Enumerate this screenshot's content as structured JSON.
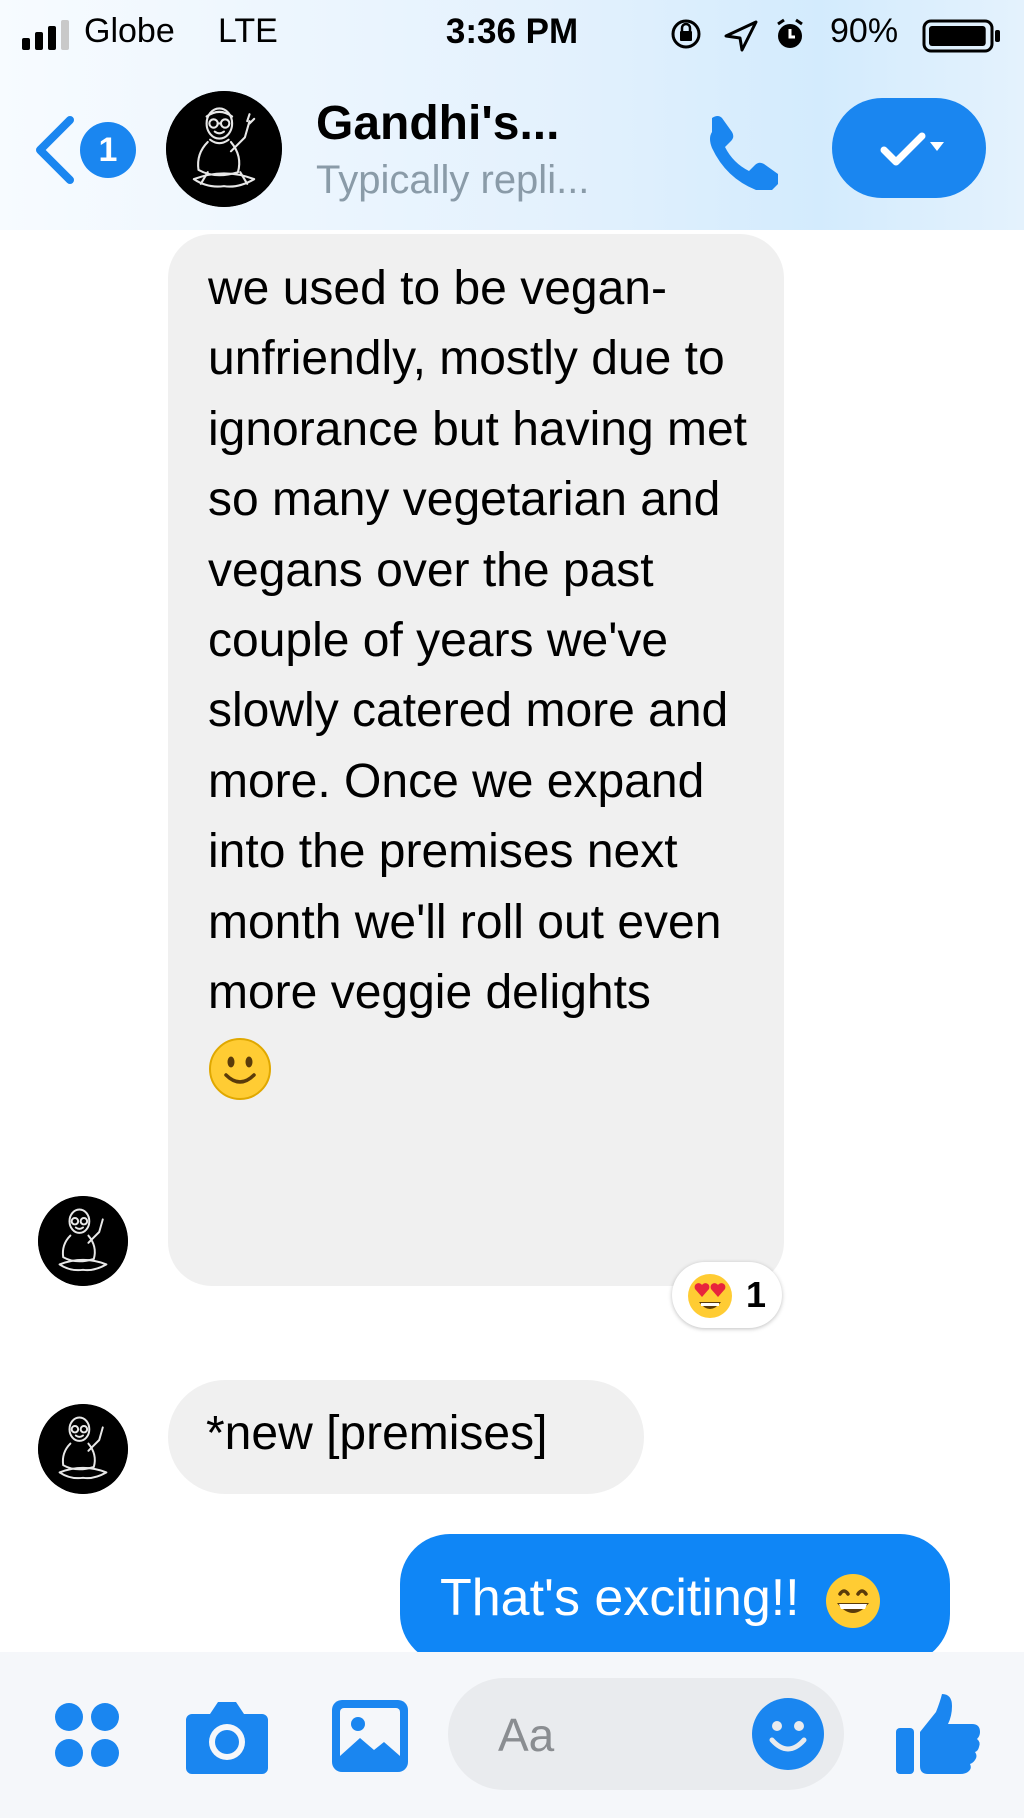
{
  "status_bar": {
    "carrier": "Globe",
    "network": "LTE",
    "time": "3:36 PM",
    "battery_percent": "90%",
    "signal_bars": 3,
    "battery_level": 0.9,
    "icons": [
      "signal-icon",
      "orientation-lock-icon",
      "location-icon",
      "alarm-icon",
      "battery-icon"
    ]
  },
  "header": {
    "back_badge_count": "1",
    "contact_name": "Gandhi's...",
    "subtitle": "Typically repli...",
    "icons": [
      "back-chevron-icon",
      "phone-icon",
      "checkmark-icon",
      "dropdown-caret-icon"
    ]
  },
  "messages": [
    {
      "sender": "contact",
      "text": "we used to be vegan-unfriendly, mostly due to ignorance but having met so many vegetarian and vegans over the past couple of years we've slowly catered more and more. Once we expand into the premises next month we'll roll out even more veggie delights",
      "trailing_emoji": "slightly-smiling-face-icon",
      "reaction": {
        "emoji": "heart-eyes-icon",
        "count": "1"
      }
    },
    {
      "sender": "contact",
      "text": "*new [premises]"
    },
    {
      "sender": "me",
      "text": "That's exciting!!",
      "trailing_emoji": "grinning-face-icon"
    }
  ],
  "composer": {
    "placeholder": "Aa",
    "icons": [
      "apps-icon",
      "camera-icon",
      "gallery-icon",
      "emoji-icon",
      "thumbs-up-icon"
    ]
  },
  "colors": {
    "accent": "#1a86f0",
    "outgoing_bubble": "#0f86f6",
    "incoming_bubble": "#f0f0f0",
    "composer_bg": "#e9ebee"
  }
}
